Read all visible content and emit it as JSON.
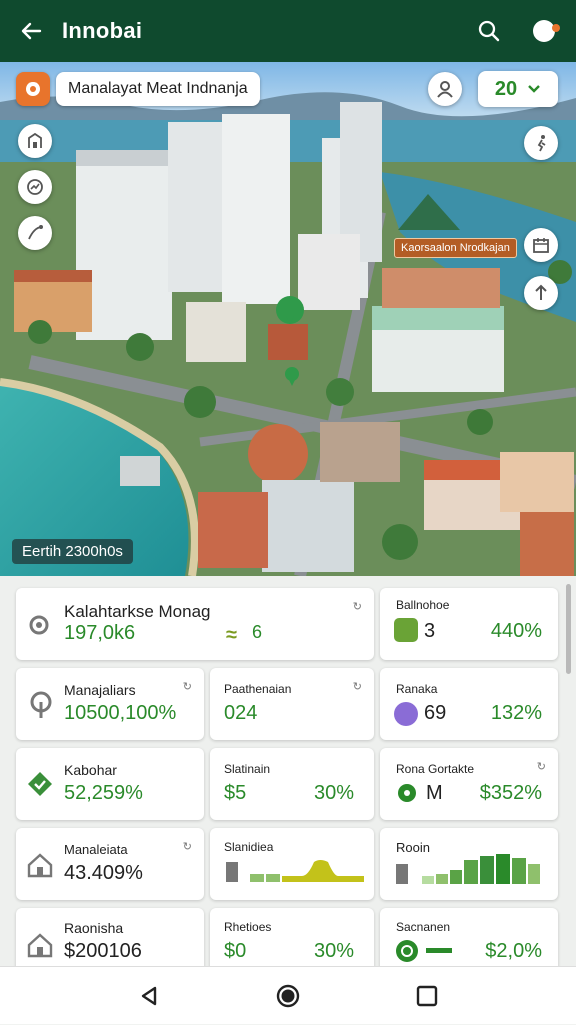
{
  "app": {
    "title": "Innobai",
    "back_icon": "arrow-left-icon",
    "search_icon": "search-icon",
    "toggle_icon": "toggle-icon",
    "brand_color": "#0f4a2e",
    "accent_color": "#2a8a2a"
  },
  "map": {
    "location_label": "Manalayat Meat Indnanja",
    "filter_value": "20",
    "tag_label": "Kaorsaalon Nrodkajan",
    "caption": "Eertih 2300h0s",
    "left_controls": [
      "building-icon",
      "chart-icon",
      "route-icon"
    ],
    "right_controls": [
      "walk-icon",
      "calendar-icon",
      "navigate-icon"
    ]
  },
  "cards": [
    {
      "title": "Kalahtarkse Monag",
      "value": "197,0k6",
      "extra": "6",
      "icon": "gear-icon"
    },
    {
      "title": "Ballnohoe",
      "value": "3",
      "extra": "440%",
      "icon": "image-icon"
    },
    {
      "title": "Manajaliars",
      "value": "10500,100%",
      "icon": "pin-icon"
    },
    {
      "title": "Paathenaian",
      "value": "024"
    },
    {
      "title": "Ranaka",
      "value": "69",
      "extra": "132%",
      "icon": "pencil-icon"
    },
    {
      "title": "Kabohar",
      "value": "52,259%",
      "icon": "badge-icon"
    },
    {
      "title": "Slatinain",
      "value": "$5",
      "extra": "30%"
    },
    {
      "title": "Rona Gortakte",
      "value": "M",
      "extra": "$352%",
      "icon": "gear-icon"
    },
    {
      "title": "Manaleiata",
      "value": "43.409%",
      "icon": "house-icon"
    },
    {
      "title": "Slanidiea",
      "chart": "bump"
    },
    {
      "title": "Rooin",
      "chart": "bars"
    },
    {
      "title": "Raonisha",
      "value": "$200106",
      "icon": "house-icon"
    },
    {
      "title": "Rhetioes",
      "value": "$0",
      "extra": "30%"
    },
    {
      "title": "Sacnanen",
      "value": "$2,0%",
      "icon": "dial-icon"
    }
  ],
  "navbar": {
    "back": "nav-back-icon",
    "home": "nav-home-icon",
    "recents": "nav-recents-icon"
  }
}
